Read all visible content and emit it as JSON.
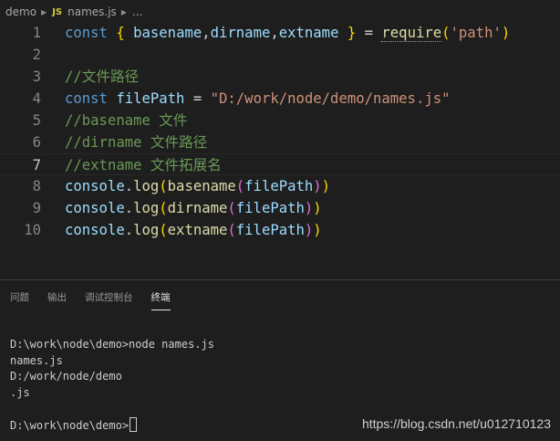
{
  "breadcrumb": {
    "folder": "demo",
    "file_badge": "JS",
    "file": "names.js",
    "more": "..."
  },
  "editor": {
    "lines": [
      {
        "num": "1",
        "tokens": [
          {
            "t": "const ",
            "c": "kw"
          },
          {
            "t": "{ ",
            "c": "b1"
          },
          {
            "t": "basename",
            "c": "var"
          },
          {
            "t": ",",
            "c": "op"
          },
          {
            "t": "dirname",
            "c": "var"
          },
          {
            "t": ",",
            "c": "op"
          },
          {
            "t": "extname",
            "c": "var"
          },
          {
            "t": " } ",
            "c": "b1"
          },
          {
            "t": "= ",
            "c": "op"
          },
          {
            "t": "require",
            "c": "fn-req"
          },
          {
            "t": "(",
            "c": "b1"
          },
          {
            "t": "'path'",
            "c": "str"
          },
          {
            "t": ")",
            "c": "b1"
          }
        ]
      },
      {
        "num": "2",
        "tokens": []
      },
      {
        "num": "3",
        "tokens": [
          {
            "t": "//文件路径",
            "c": "cm"
          }
        ]
      },
      {
        "num": "4",
        "tokens": [
          {
            "t": "const ",
            "c": "kw"
          },
          {
            "t": "filePath",
            "c": "var"
          },
          {
            "t": " = ",
            "c": "op"
          },
          {
            "t": "\"D:/work/node/demo/names.js\"",
            "c": "str"
          }
        ]
      },
      {
        "num": "5",
        "tokens": [
          {
            "t": "//basename 文件",
            "c": "cm"
          }
        ]
      },
      {
        "num": "6",
        "tokens": [
          {
            "t": "//dirname 文件路径",
            "c": "cm"
          }
        ]
      },
      {
        "num": "7",
        "tokens": [
          {
            "t": "//extname 文件拓展名",
            "c": "cm"
          }
        ],
        "current": true
      },
      {
        "num": "8",
        "tokens": [
          {
            "t": "console",
            "c": "var"
          },
          {
            "t": ".",
            "c": "op"
          },
          {
            "t": "log",
            "c": "fn"
          },
          {
            "t": "(",
            "c": "b1"
          },
          {
            "t": "basename",
            "c": "fn"
          },
          {
            "t": "(",
            "c": "b2"
          },
          {
            "t": "filePath",
            "c": "var"
          },
          {
            "t": ")",
            "c": "b2"
          },
          {
            "t": ")",
            "c": "b1"
          }
        ]
      },
      {
        "num": "9",
        "tokens": [
          {
            "t": "console",
            "c": "var"
          },
          {
            "t": ".",
            "c": "op"
          },
          {
            "t": "log",
            "c": "fn"
          },
          {
            "t": "(",
            "c": "b1"
          },
          {
            "t": "dirname",
            "c": "fn"
          },
          {
            "t": "(",
            "c": "b2"
          },
          {
            "t": "filePath",
            "c": "var"
          },
          {
            "t": ")",
            "c": "b2"
          },
          {
            "t": ")",
            "c": "b1"
          }
        ]
      },
      {
        "num": "10",
        "tokens": [
          {
            "t": "console",
            "c": "var"
          },
          {
            "t": ".",
            "c": "op"
          },
          {
            "t": "log",
            "c": "fn"
          },
          {
            "t": "(",
            "c": "b1"
          },
          {
            "t": "extname",
            "c": "fn"
          },
          {
            "t": "(",
            "c": "b2"
          },
          {
            "t": "filePath",
            "c": "var"
          },
          {
            "t": ")",
            "c": "b2"
          },
          {
            "t": ")",
            "c": "b1"
          }
        ]
      }
    ]
  },
  "panel": {
    "tabs": [
      {
        "label": "问题",
        "name": "tab-problems"
      },
      {
        "label": "输出",
        "name": "tab-output"
      },
      {
        "label": "调试控制台",
        "name": "tab-debug-console"
      },
      {
        "label": "终端",
        "name": "tab-terminal",
        "active": true
      }
    ],
    "terminal_lines": [
      "D:\\work\\node\\demo>node names.js",
      "names.js",
      "D:/work/node/demo",
      ".js",
      "",
      "D:\\work\\node\\demo>"
    ]
  },
  "watermark": "https://blog.csdn.net/u012710123"
}
